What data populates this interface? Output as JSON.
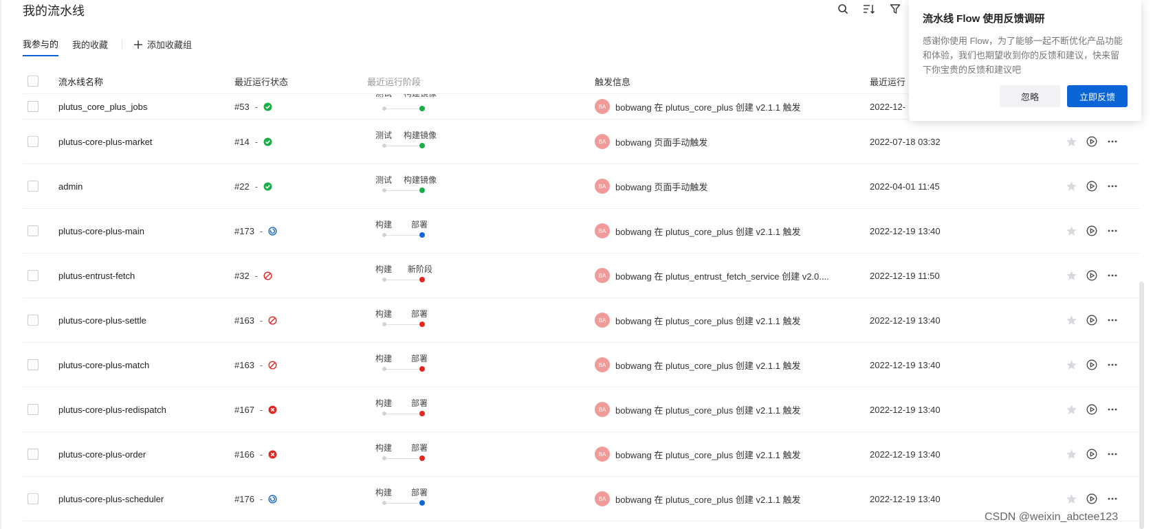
{
  "page": {
    "title": "我的流水线"
  },
  "toolbar": {
    "icons": [
      "search-icon",
      "sort-icon",
      "filter-icon"
    ]
  },
  "tabs": [
    {
      "label": "我参与的",
      "active": true
    },
    {
      "label": "我的收藏",
      "active": false
    }
  ],
  "add_group_label": "添加收藏组",
  "table": {
    "headers": {
      "name": "流水线名称",
      "status": "最近运行状态",
      "stage": "最近运行阶段",
      "trigger": "触发信息",
      "time": "最近运行"
    },
    "rows": [
      {
        "name": "plutus_core_plus_jobs",
        "run": "#53",
        "dash": "-",
        "status": "success",
        "stages": [
          "测试",
          "构建镜像"
        ],
        "stage_color": "#1aad48",
        "avatar": "BA",
        "trigger": "bobwang 在 plutus_core_plus 创建 v2.1.1 触发",
        "time": "2022-12-"
      },
      {
        "name": "plutus-core-plus-market",
        "run": "#14",
        "dash": "-",
        "status": "success",
        "stages": [
          "测试",
          "构建镜像"
        ],
        "stage_color": "#1aad48",
        "avatar": "BA",
        "trigger": "bobwang 页面手动触发",
        "time": "2022-07-18 03:32"
      },
      {
        "name": "admin",
        "run": "#22",
        "dash": "-",
        "status": "success",
        "stages": [
          "测试",
          "构建镜像"
        ],
        "stage_color": "#1aad48",
        "avatar": "BA",
        "trigger": "bobwang 页面手动触发",
        "time": "2022-04-01 11:45"
      },
      {
        "name": "plutus-core-plus-main",
        "run": "#173",
        "dash": "-",
        "status": "running",
        "stages": [
          "构建",
          "部署"
        ],
        "stage_color": "#1068d8",
        "avatar": "BA",
        "trigger": "bobwang 在 plutus_core_plus 创建 v2.1.1 触发",
        "time": "2022-12-19 13:40"
      },
      {
        "name": "plutus-entrust-fetch",
        "run": "#32",
        "dash": "-",
        "status": "cancelled",
        "stages": [
          "构建",
          "新阶段"
        ],
        "stage_color": "#e5261f",
        "avatar": "BA",
        "trigger": "bobwang 在 plutus_entrust_fetch_service 创建 v2.0....",
        "time": "2022-12-19 11:50"
      },
      {
        "name": "plutus-core-plus-settle",
        "run": "#163",
        "dash": "-",
        "status": "cancelled",
        "stages": [
          "构建",
          "部署"
        ],
        "stage_color": "#e5261f",
        "avatar": "BA",
        "trigger": "bobwang 在 plutus_core_plus 创建 v2.1.1 触发",
        "time": "2022-12-19 13:40"
      },
      {
        "name": "plutus-core-plus-match",
        "run": "#163",
        "dash": "-",
        "status": "cancelled",
        "stages": [
          "构建",
          "部署"
        ],
        "stage_color": "#e5261f",
        "avatar": "BA",
        "trigger": "bobwang 在 plutus_core_plus 创建 v2.1.1 触发",
        "time": "2022-12-19 13:40"
      },
      {
        "name": "plutus-core-plus-redispatch",
        "run": "#167",
        "dash": "-",
        "status": "failed",
        "stages": [
          "构建",
          "部署"
        ],
        "stage_color": "#e5261f",
        "avatar": "BA",
        "trigger": "bobwang 在 plutus_core_plus 创建 v2.1.1 触发",
        "time": "2022-12-19 13:40"
      },
      {
        "name": "plutus-core-plus-order",
        "run": "#166",
        "dash": "-",
        "status": "failed",
        "stages": [
          "构建",
          "部署"
        ],
        "stage_color": "#e5261f",
        "avatar": "BA",
        "trigger": "bobwang 在 plutus_core_plus 创建 v2.1.1 触发",
        "time": "2022-12-19 13:40"
      },
      {
        "name": "plutus-core-plus-scheduler",
        "run": "#176",
        "dash": "-",
        "status": "running",
        "stages": [
          "构建",
          "部署"
        ],
        "stage_color": "#1068d8",
        "avatar": "BA",
        "trigger": "bobwang 在 plutus_core_plus 创建 v2.1.1 触发",
        "time": "2022-12-19 13:40"
      }
    ]
  },
  "colors": {
    "primary": "#0a64d6",
    "success": "#1aad48",
    "running": "#1068d8",
    "error": "#e5261f",
    "avatar": "#f19a9a"
  },
  "popover": {
    "title": "流水线 Flow 使用反馈调研",
    "body": "感谢你使用 Flow，为了能够一起不断优化产品功能和体验，我们也期望收到你的反馈和建议，快来留下你宝贵的反馈和建议吧",
    "ignore_label": "忽略",
    "feedback_label": "立即反馈"
  },
  "watermark": "CSDN @weixin_abctee123"
}
